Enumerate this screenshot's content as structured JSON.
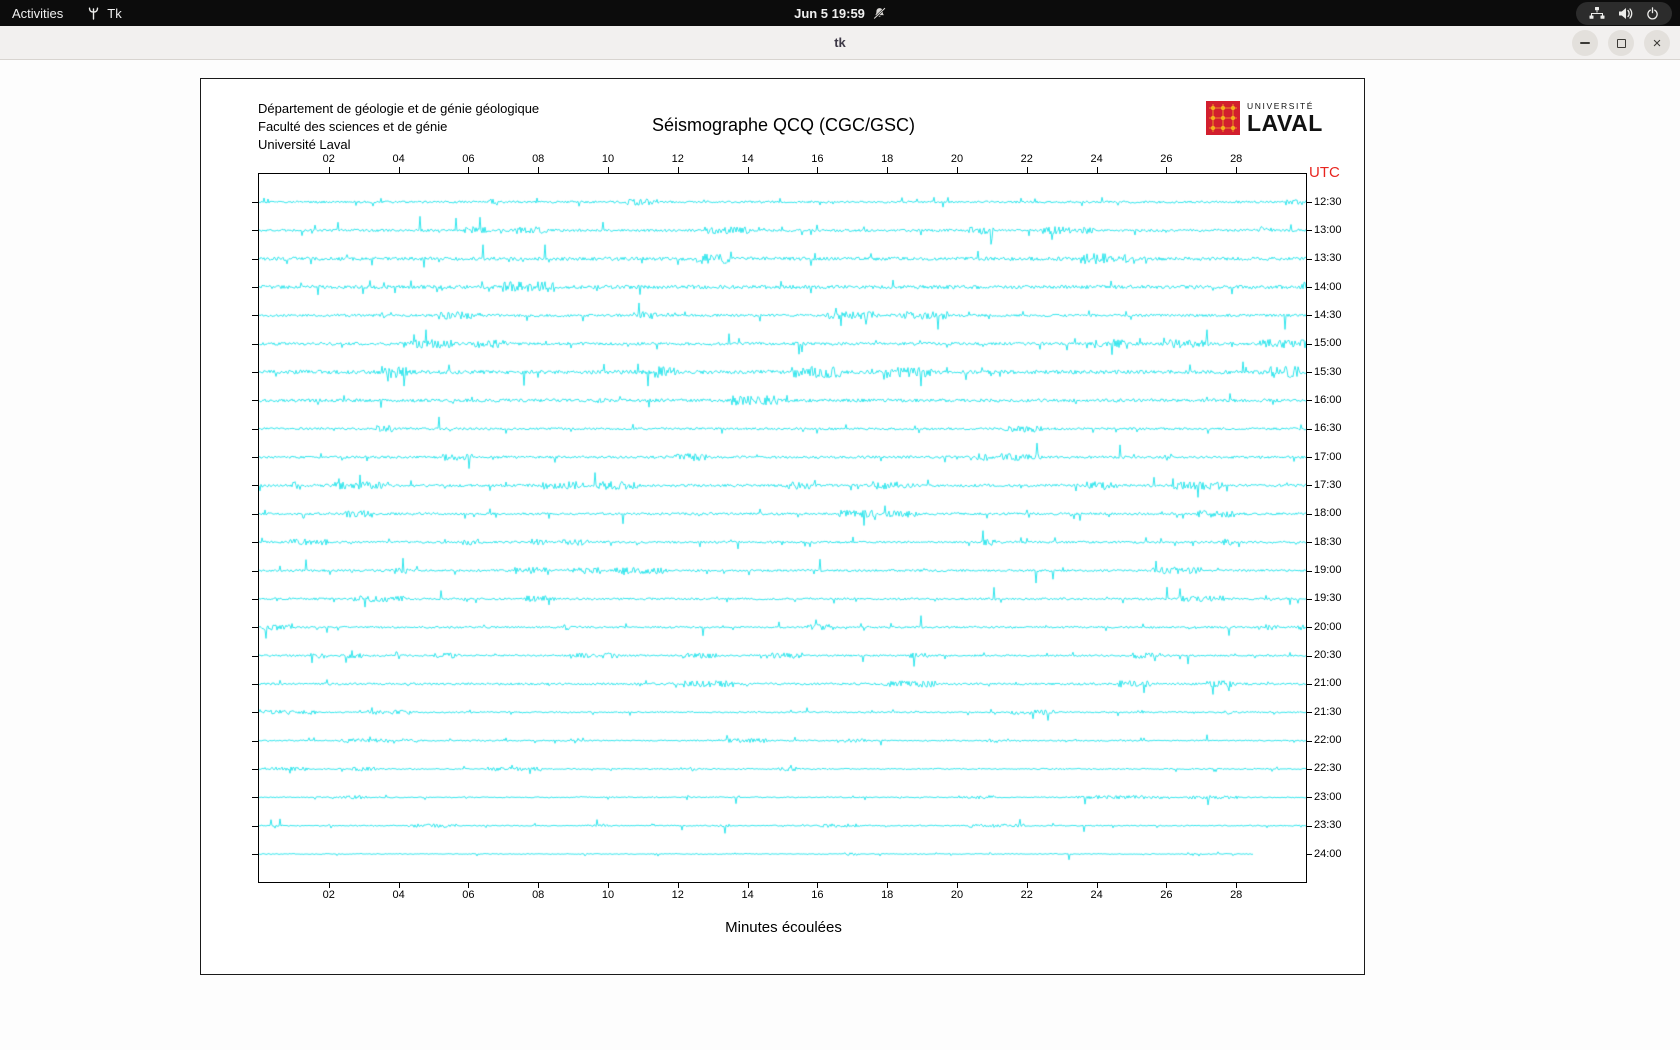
{
  "topbar": {
    "activities_label": "Activities",
    "app_name": "Tk",
    "clock": "Jun 5 19:59"
  },
  "titlebar": {
    "title": "tk"
  },
  "icons": {
    "close_glyph": "×"
  },
  "document": {
    "header_lines": [
      "Département de géologie et de génie géologique",
      "Faculté des sciences et de génie",
      "Université Laval"
    ],
    "title": "Séismographe QCQ (CGC/GSC)",
    "xlabel": "Minutes écoulées",
    "utc_label": "UTC",
    "logo": {
      "line1": "UNIVERSITÉ",
      "line2": "LAVAL"
    }
  },
  "chart_data": {
    "type": "line",
    "title": "Séismographe QCQ (CGC/GSC)",
    "xlabel": "Minutes écoulées",
    "x_range_minutes": [
      0,
      30
    ],
    "x_tick_minutes": [
      2,
      4,
      6,
      8,
      10,
      12,
      14,
      16,
      18,
      20,
      22,
      24,
      26,
      28
    ],
    "x_tick_labels": [
      "02",
      "04",
      "06",
      "08",
      "10",
      "12",
      "14",
      "16",
      "18",
      "20",
      "22",
      "24",
      "26",
      "28"
    ],
    "trace_color": "#00dfe8",
    "utc_axis_color": "#e8251f",
    "rows": [
      {
        "utc": "12:30",
        "amp": 1.0,
        "end": 1.0
      },
      {
        "utc": "13:00",
        "amp": 1.15,
        "end": 1.0
      },
      {
        "utc": "13:30",
        "amp": 1.6,
        "end": 1.0
      },
      {
        "utc": "14:00",
        "amp": 1.65,
        "end": 1.0
      },
      {
        "utc": "14:30",
        "amp": 1.2,
        "end": 1.0
      },
      {
        "utc": "15:00",
        "amp": 1.35,
        "end": 1.0
      },
      {
        "utc": "15:30",
        "amp": 1.75,
        "end": 1.0
      },
      {
        "utc": "16:00",
        "amp": 1.5,
        "end": 1.0
      },
      {
        "utc": "16:30",
        "amp": 1.05,
        "end": 1.0
      },
      {
        "utc": "17:00",
        "amp": 1.15,
        "end": 1.0
      },
      {
        "utc": "17:30",
        "amp": 1.25,
        "end": 1.0
      },
      {
        "utc": "18:00",
        "amp": 1.1,
        "end": 1.0
      },
      {
        "utc": "18:30",
        "amp": 1.0,
        "end": 1.0
      },
      {
        "utc": "19:00",
        "amp": 1.0,
        "end": 1.0
      },
      {
        "utc": "19:30",
        "amp": 0.95,
        "end": 1.0
      },
      {
        "utc": "20:00",
        "amp": 0.9,
        "end": 1.0
      },
      {
        "utc": "20:30",
        "amp": 0.85,
        "end": 1.0
      },
      {
        "utc": "21:00",
        "amp": 1.0,
        "end": 1.0
      },
      {
        "utc": "21:30",
        "amp": 0.7,
        "end": 1.0
      },
      {
        "utc": "22:00",
        "amp": 0.65,
        "end": 1.0
      },
      {
        "utc": "22:30",
        "amp": 0.6,
        "end": 1.0
      },
      {
        "utc": "23:00",
        "amp": 0.55,
        "end": 1.0
      },
      {
        "utc": "23:30",
        "amp": 0.55,
        "end": 1.0
      },
      {
        "utc": "24:00",
        "amp": 0.45,
        "end": 0.95
      }
    ]
  }
}
